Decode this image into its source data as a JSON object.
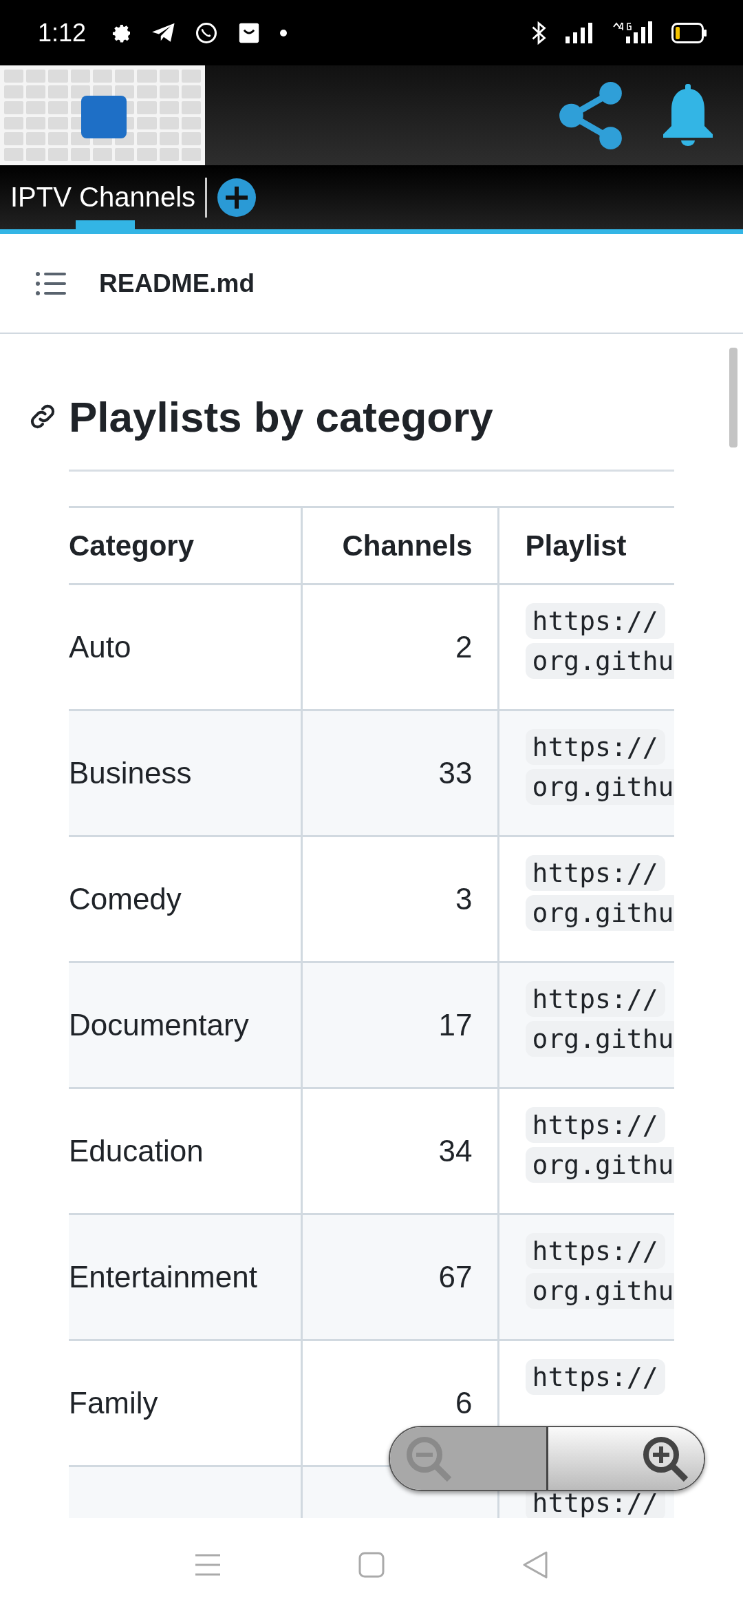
{
  "status_bar": {
    "time": "1:12"
  },
  "app_header": {
    "tabs": [
      {
        "label": "IPTV Channels",
        "selected": true
      }
    ]
  },
  "file_header": {
    "filename": "README.md"
  },
  "heading": "Playlists by category",
  "table": {
    "columns": [
      "Category",
      "Channels",
      "Playlist"
    ],
    "rows": [
      {
        "category": "Auto",
        "channels": "2",
        "playlist": [
          "https://",
          "org.githu"
        ]
      },
      {
        "category": "Business",
        "channels": "33",
        "playlist": [
          "https://",
          "org.githu"
        ]
      },
      {
        "category": "Comedy",
        "channels": "3",
        "playlist": [
          "https://",
          "org.githu"
        ]
      },
      {
        "category": "Documentary",
        "channels": "17",
        "playlist": [
          "https://",
          "org.githu"
        ]
      },
      {
        "category": "Education",
        "channels": "34",
        "playlist": [
          "https://",
          "org.githu"
        ]
      },
      {
        "category": "Entertainment",
        "channels": "67",
        "playlist": [
          "https://",
          "org.githu"
        ]
      },
      {
        "category": "Family",
        "channels": "6",
        "playlist": [
          "https://"
        ]
      },
      {
        "playlist": [
          "https://"
        ]
      }
    ]
  }
}
